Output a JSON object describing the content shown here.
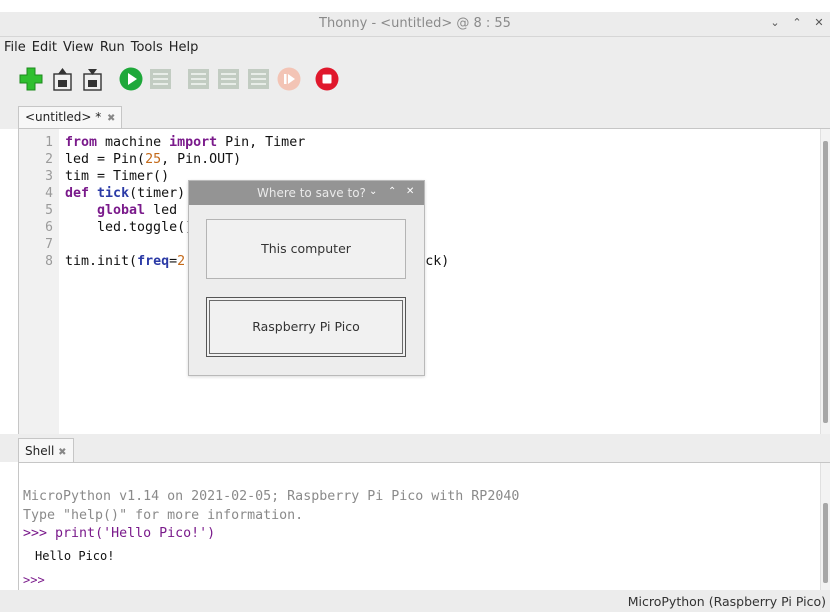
{
  "window": {
    "title": "Thonny  -  <untitled>  @  8 : 55",
    "controls": [
      "⌄",
      "⌃",
      "✕"
    ]
  },
  "menu": [
    "File",
    "Edit",
    "View",
    "Run",
    "Tools",
    "Help"
  ],
  "toolbar": {
    "icons": [
      "new-file-icon",
      "open-file-icon",
      "save-file-icon",
      "run-icon",
      "debug-icon",
      "step-over-icon",
      "step-into-icon",
      "step-out-icon",
      "resume-icon",
      "stop-icon"
    ],
    "colors": {
      "new": "#2fbf2f",
      "run": "#1ea83a",
      "stop": "#e0182c",
      "disabled": "#b9c6b9"
    }
  },
  "editor": {
    "tab_label": "<untitled> *",
    "tab_close": "✖",
    "line_numbers": [
      "1",
      "2",
      "3",
      "4",
      "5",
      "6",
      "7",
      "8"
    ]
  },
  "shell": {
    "tab_label": "Shell",
    "tab_close": "✖",
    "banner_line1": "MicroPython v1.14 on 2021-02-05; Raspberry Pi Pico with RP2040",
    "banner_line2": "Type \"help()\" for more information.",
    "prompt": ">>>",
    "command": " print('Hello Pico!')",
    "output": "Hello Pico!",
    "prompt2": ">>>"
  },
  "dialog": {
    "title": "Where to save to?",
    "controls": [
      "⌄",
      "⌃",
      "✕"
    ],
    "option_computer": "This computer",
    "option_pico": "Raspberry Pi Pico"
  },
  "status": {
    "interpreter": "MicroPython (Raspberry Pi Pico)"
  }
}
